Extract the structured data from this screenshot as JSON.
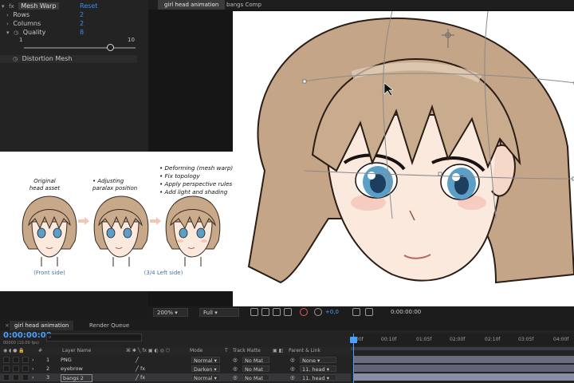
{
  "effects": {
    "effect_name": "Mesh Warp",
    "reset_label": "Reset",
    "params": [
      {
        "label": "Rows",
        "value": "2"
      },
      {
        "label": "Columns",
        "value": "2"
      },
      {
        "label": "Quality",
        "value": "8"
      }
    ],
    "slider_min": "1",
    "slider_max": "10",
    "distortion_mesh_label": "Distortion Mesh"
  },
  "viewer": {
    "tabs": [
      "girl head animation",
      "bangs Comp"
    ],
    "tab_separator": "‹",
    "zoom": "200%",
    "resolution": "Full",
    "exposure": "+0,0",
    "timecode": "0:00:00:00"
  },
  "infographic": {
    "bullets": [
      "• Deforming (mesh warp)",
      "• Fix topology",
      "• Apply perspective rules",
      "• Add light and shading"
    ],
    "caption_left_1": "Original",
    "caption_left_2": "head asset",
    "caption_mid_1": "• Adjusting",
    "caption_mid_2": "paralax position",
    "sub_left": "(Front side)",
    "sub_mid": "(3/4 Left side)"
  },
  "timeline": {
    "tabs": [
      "girl head animation",
      "Render Queue"
    ],
    "timecode": "0:00:00:00",
    "fps": "00000 (10.00 fps)",
    "search_placeholder": "",
    "headers": {
      "num": "#",
      "layer": "Layer Name",
      "mode": "Mode",
      "t": "T",
      "matte": "Track Matte",
      "parent": "Parent & Link"
    },
    "ruler": [
      "00f",
      "00:10f",
      "01:05f",
      "02:00f",
      "02:10f",
      "03:05f",
      "04:00f"
    ],
    "layers": [
      {
        "num": "1",
        "name": "PNG",
        "mode": "Normal",
        "matte": "No Mat",
        "parent": "None"
      },
      {
        "num": "2",
        "name": "eyebrow",
        "mode": "Darken",
        "matte": "No Mat",
        "parent": "11. head"
      },
      {
        "num": "3",
        "name": "bangs 2",
        "mode": "Normal",
        "matte": "No Mat",
        "parent": "11. head"
      }
    ]
  },
  "colors": {
    "accent": "#3d8ef0",
    "timecode": "#4aa1ff",
    "hair": "#c7a98a",
    "eye": "#5b9fc6"
  }
}
